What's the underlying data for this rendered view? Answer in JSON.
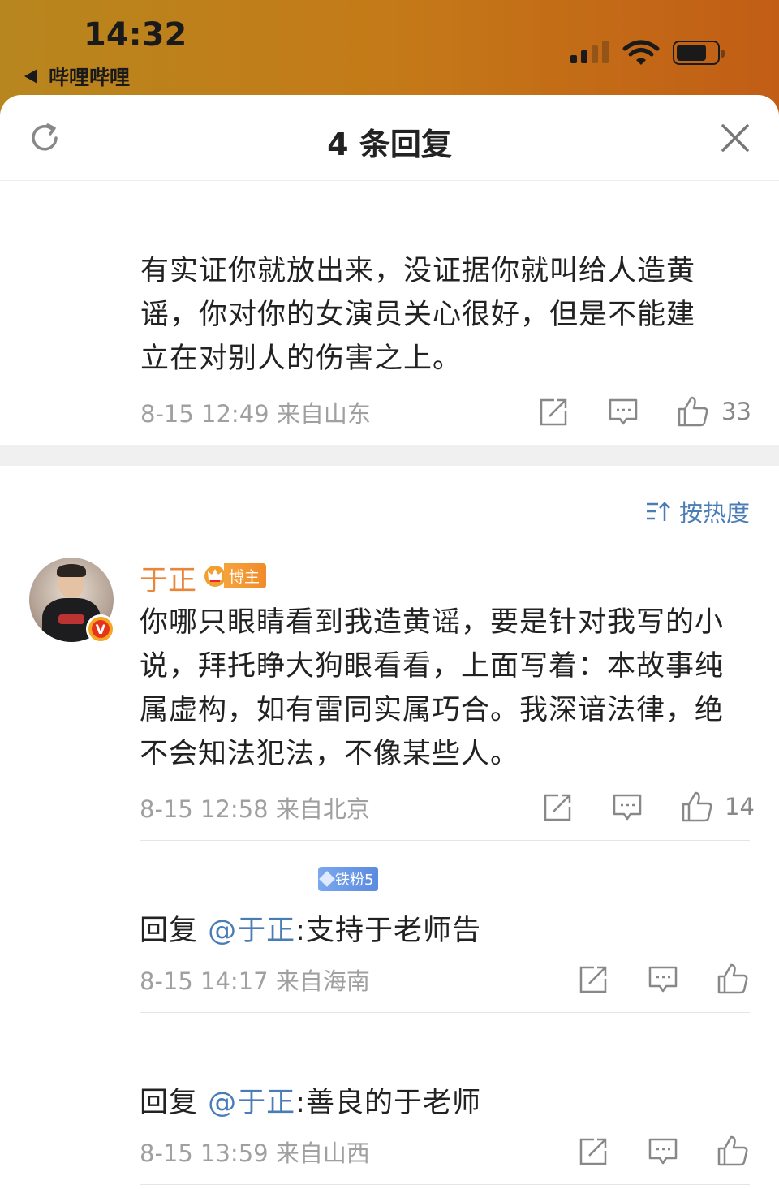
{
  "status_bar": {
    "time": "14:32",
    "back_app": "哔哩哔哩"
  },
  "sheet": {
    "title": "4 条回复"
  },
  "first_comment": {
    "lines": [
      "有实证你就放出来，没证据你就叫给人造黄",
      "谣，你对你的女演员关心很好，但是不能建",
      "立在对别人的伤害之上。"
    ],
    "meta": "8-15 12:49  来自山东",
    "likes": "33"
  },
  "sort": {
    "label": "按热度"
  },
  "main_comment": {
    "username": "于正",
    "badge": "博主",
    "lines": [
      "你哪只眼睛看到我造黄谣，要是针对我写的小",
      "说，拜托睁大狗眼看看，上面写着：本故事纯",
      "属虚构，如有雷同实属巧合。我深谙法律，绝",
      "不会知法犯法，不像某些人。"
    ],
    "meta": "8-15 12:58  来自北京",
    "likes": "14"
  },
  "replies": [
    {
      "fan_badge": "铁粉5",
      "prefix": "回复 ",
      "mention": "@于正",
      "text": ":支持于老师告",
      "meta": "8-15 14:17  来自海南"
    },
    {
      "prefix": "回复 ",
      "mention": "@于正",
      "text": ":善良的于老师",
      "meta": "8-15 13:59  来自山西"
    }
  ],
  "colors": {
    "accent_link": "#4a7db6",
    "username": "#e8863a",
    "meta": "#a0a0a0"
  }
}
